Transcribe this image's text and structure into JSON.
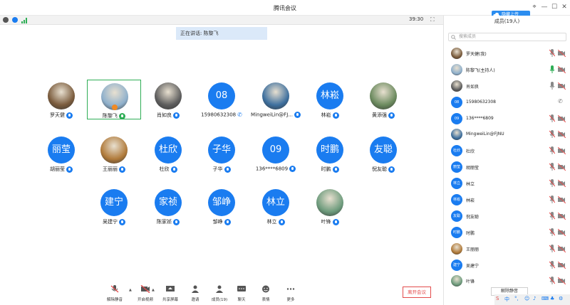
{
  "window": {
    "title": "腾讯会议",
    "cloud_upload": "隐藏上传"
  },
  "info": {
    "time": "39:30"
  },
  "banner": {
    "speaking": "正在讲话: 陈黎飞"
  },
  "grid": [
    {
      "name": "罗天健",
      "avatar": "photo",
      "color": "#7a5b3c",
      "icon": "mic"
    },
    {
      "name": "陈黎飞",
      "avatar": "photo",
      "color": "#8fb0cc",
      "icon": "mic-green",
      "active": true
    },
    {
      "name": "肖如良",
      "avatar": "photo",
      "color": "#5d5d5d",
      "icon": "mic"
    },
    {
      "name": "15980632308",
      "avatar": "text",
      "label": "08",
      "icon": "phone"
    },
    {
      "name": "MingweiLin@FJ...",
      "avatar": "photo",
      "color": "#3d6f9e",
      "icon": "mic"
    },
    {
      "name": "林崧",
      "avatar": "text",
      "label": "林崧",
      "icon": "mic"
    },
    {
      "name": "黄添强",
      "avatar": "photo",
      "color": "#6b8a5e",
      "icon": "mic"
    },
    {
      "name": "胡丽莹",
      "avatar": "text",
      "label": "丽莹",
      "icon": "mic"
    },
    {
      "name": "王丽丽",
      "avatar": "photo",
      "color": "#b07a3a",
      "icon": "mic"
    },
    {
      "name": "杜欣",
      "avatar": "text",
      "label": "杜欣",
      "icon": "mic"
    },
    {
      "name": "子华",
      "avatar": "text",
      "label": "子华",
      "icon": "mic"
    },
    {
      "name": "136****6809",
      "avatar": "text",
      "label": "09",
      "icon": "mic"
    },
    {
      "name": "时鹏",
      "avatar": "text",
      "label": "时鹏",
      "icon": "mic"
    },
    {
      "name": "倪友聪",
      "avatar": "text",
      "label": "友聪",
      "icon": "mic"
    },
    {
      "name": "吴建宁",
      "avatar": "text",
      "label": "建宁",
      "icon": "mic"
    },
    {
      "name": "陈家祯",
      "avatar": "text",
      "label": "家祯",
      "icon": "mic"
    },
    {
      "name": "邹峥",
      "avatar": "text",
      "label": "邹峥",
      "icon": "mic"
    },
    {
      "name": "林立",
      "avatar": "text",
      "label": "林立",
      "icon": "mic"
    },
    {
      "name": "叶锋",
      "avatar": "photo",
      "color": "#6d9b7c",
      "icon": "mic"
    }
  ],
  "toolbar": {
    "items": [
      {
        "label": "解除静音",
        "icon": "mic-muted-icon"
      },
      {
        "label": "开启视频",
        "icon": "camera-off-icon"
      },
      {
        "label": "共享屏幕",
        "icon": "share-screen-icon"
      },
      {
        "label": "邀请",
        "icon": "invite-icon"
      },
      {
        "label": "成员(19)",
        "icon": "members-icon"
      },
      {
        "label": "聊天",
        "icon": "chat-icon"
      },
      {
        "label": "表情",
        "icon": "emoji-icon"
      },
      {
        "label": "更多",
        "icon": "more-icon"
      }
    ],
    "end_meeting": "离开会议"
  },
  "panel": {
    "title": "成员(19人)",
    "search_placeholder": "搜索成员",
    "mute_all": "解除静音",
    "members": [
      {
        "name": "罗天健(我)",
        "avatar": "photo",
        "color": "#7a5b3c",
        "mic": "muted",
        "cam": "off"
      },
      {
        "name": "陈黎飞(主持人)",
        "avatar": "photo",
        "color": "#8fb0cc",
        "mic": "active",
        "cam": "off"
      },
      {
        "name": "肖如良",
        "avatar": "photo",
        "color": "#5d5d5d",
        "mic": "on",
        "cam": "off"
      },
      {
        "name": "15980632308",
        "avatar": "text",
        "label": "08",
        "mic": "phone",
        "cam": "none"
      },
      {
        "name": "136****6809",
        "avatar": "text",
        "label": "09",
        "mic": "muted",
        "cam": "off"
      },
      {
        "name": "MingweiLin@FJNU",
        "avatar": "photo",
        "color": "#3d6f9e",
        "mic": "muted",
        "cam": "off"
      },
      {
        "name": "杜欣",
        "avatar": "text",
        "label": "杜欣",
        "mic": "muted",
        "cam": "off"
      },
      {
        "name": "胡丽莹",
        "avatar": "text",
        "label": "丽莹",
        "mic": "muted",
        "cam": "off"
      },
      {
        "name": "林立",
        "avatar": "text",
        "label": "林立",
        "mic": "muted",
        "cam": "off"
      },
      {
        "name": "林崧",
        "avatar": "text",
        "label": "林崧",
        "mic": "muted",
        "cam": "off"
      },
      {
        "name": "倪友聪",
        "avatar": "text",
        "label": "友聪",
        "mic": "muted",
        "cam": "off"
      },
      {
        "name": "时鹏",
        "avatar": "text",
        "label": "时鹏",
        "mic": "muted",
        "cam": "off"
      },
      {
        "name": "王丽丽",
        "avatar": "photo",
        "color": "#b07a3a",
        "mic": "muted",
        "cam": "off"
      },
      {
        "name": "吴建宁",
        "avatar": "text",
        "label": "建宁",
        "mic": "muted",
        "cam": "off"
      },
      {
        "name": "叶锋",
        "avatar": "photo",
        "color": "#6d9b7c",
        "mic": "muted",
        "cam": "off"
      }
    ]
  },
  "tray": {
    "ime": "中"
  }
}
